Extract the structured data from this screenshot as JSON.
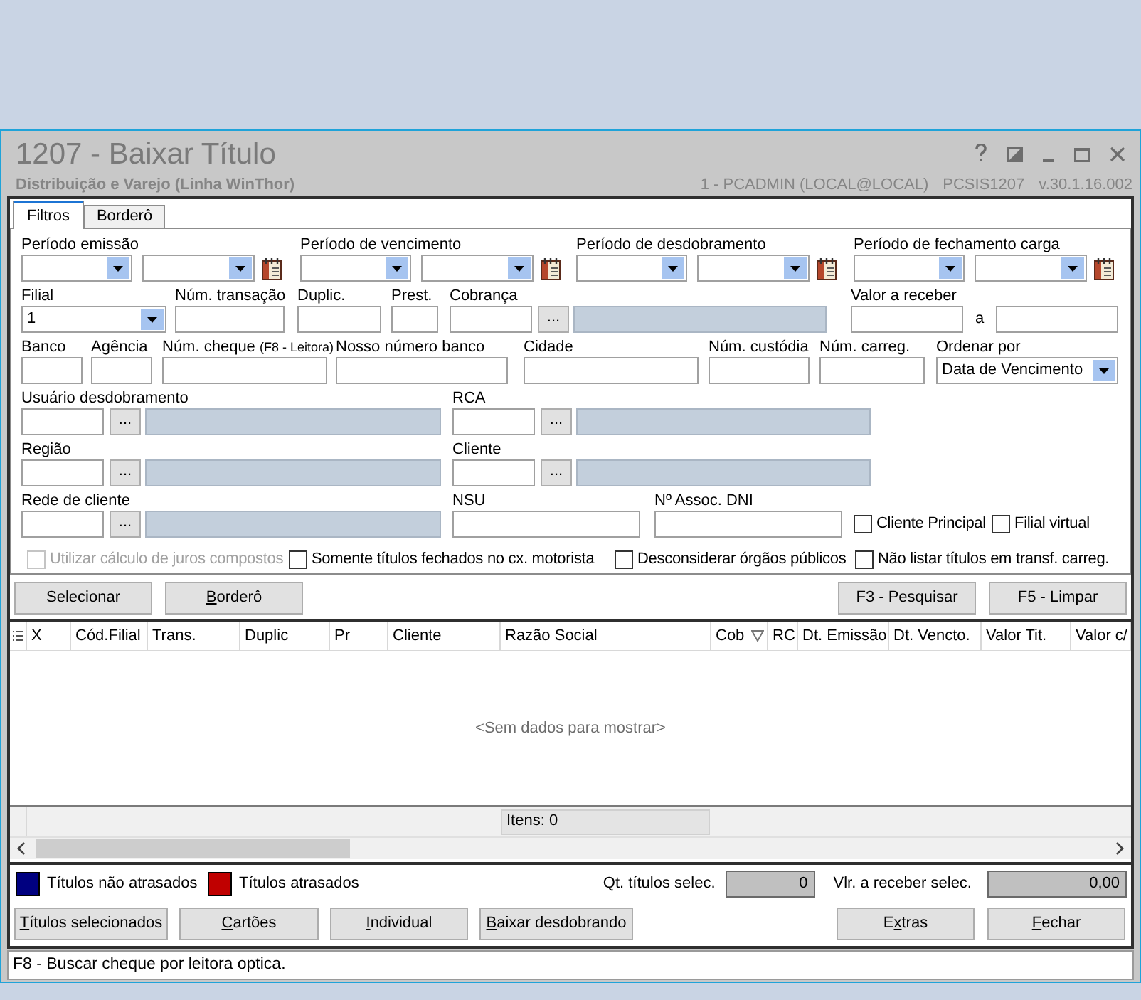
{
  "window": {
    "title": "1207 - Baixar Título",
    "subtitle": "Distribuição e Varejo (Linha WinThor)",
    "user": "1 - PCADMIN (LOCAL@LOCAL)",
    "program": "PCSIS1207",
    "version": "v.30.1.16.002"
  },
  "tabs": [
    {
      "label": "Filtros",
      "selected": true
    },
    {
      "label": "Borderô",
      "selected": false
    }
  ],
  "rows": [
    [
      {
        "kind": "period",
        "label": "Período emissão"
      },
      {
        "kind": "period",
        "label": "Período de vencimento"
      },
      {
        "kind": "period",
        "label": "Período de desdobramento"
      },
      {
        "kind": "period",
        "label": "Período de fechamento carga"
      }
    ],
    [
      {
        "kind": "combo",
        "label": "Filial",
        "value": "1"
      },
      {
        "kind": "text",
        "label": "Núm. transação"
      },
      {
        "kind": "text",
        "label": "Duplic."
      },
      {
        "kind": "text",
        "label": "Prest."
      },
      {
        "kind": "lookup",
        "label": "Cobrança",
        "button": "..."
      },
      {
        "kind": "range",
        "label": "Valor a receber",
        "separator": "a"
      }
    ],
    [
      {
        "kind": "text",
        "label": "Banco"
      },
      {
        "kind": "text",
        "label": "Agência"
      },
      {
        "kind": "text",
        "label": "Núm. cheque",
        "note": "(F8 - Leitora)"
      },
      {
        "kind": "text",
        "label": "Nosso número banco"
      },
      {
        "kind": "text",
        "label": "Cidade"
      },
      {
        "kind": "text",
        "label": "Núm. custódia"
      },
      {
        "kind": "text",
        "label": "Núm. carreg."
      },
      {
        "kind": "combo",
        "label": "Ordenar por",
        "value": "Data de Vencimento"
      }
    ],
    [
      {
        "kind": "lookup",
        "label": "Usuário desdobramento",
        "button": "..."
      },
      {
        "kind": "lookup",
        "label": "RCA",
        "button": "..."
      }
    ],
    [
      {
        "kind": "lookup",
        "label": "Região",
        "button": "..."
      },
      {
        "kind": "lookup",
        "label": "Cliente",
        "button": "..."
      }
    ],
    [
      {
        "kind": "lookup",
        "label": "Rede de cliente",
        "button": "..."
      },
      {
        "kind": "text",
        "label": "NSU"
      },
      {
        "kind": "text",
        "label": "Nº Assoc. DNI"
      },
      {
        "kind": "checkbox",
        "label": "Cliente Principal",
        "checked": false,
        "disabled": false
      },
      {
        "kind": "checkbox",
        "label": "Filial virtual",
        "checked": false,
        "disabled": false
      }
    ]
  ],
  "options": [
    {
      "label": "Utilizar cálculo de juros compostos",
      "checked": false,
      "disabled": true
    },
    {
      "label": "Somente títulos fechados no cx. motorista",
      "checked": false,
      "disabled": false
    },
    {
      "label": "Desconsiderar órgãos públicos",
      "checked": false,
      "disabled": false
    },
    {
      "label": "Não listar títulos em transf. carreg.",
      "checked": false,
      "disabled": false
    }
  ],
  "actions": [
    {
      "label": "Selecionar"
    },
    {
      "label": "Borderô"
    },
    {
      "label": "F3 - Pesquisar"
    },
    {
      "label": "F5 - Limpar"
    }
  ],
  "grid": {
    "columns": [
      {
        "label": "X",
        "filter": false
      },
      {
        "label": "Cód.Filial",
        "filter": false
      },
      {
        "label": "Trans.",
        "filter": false
      },
      {
        "label": "Duplic",
        "filter": false
      },
      {
        "label": "Pr",
        "filter": false
      },
      {
        "label": "Cliente",
        "filter": false
      },
      {
        "label": "Razão Social",
        "filter": false
      },
      {
        "label": "Cob",
        "filter": true
      },
      {
        "label": "RC",
        "filter": false
      },
      {
        "label": "Dt. Emissão",
        "filter": false
      },
      {
        "label": "Dt. Vencto.",
        "filter": false
      },
      {
        "label": "Valor Tit.",
        "filter": false
      },
      {
        "label": "Valor c/",
        "filter": false
      }
    ],
    "empty_text": "<Sem dados para mostrar>",
    "footer": "Itens: 0"
  },
  "legend": [
    {
      "label": "Títulos não atrasados",
      "color": "#000080"
    },
    {
      "label": "Títulos atrasados",
      "color": "#c00000"
    }
  ],
  "totals": [
    {
      "label": "Qt. títulos selec.",
      "value": "0"
    },
    {
      "label": "Vlr. a receber selec.",
      "value": "0,00"
    }
  ],
  "buttons": [
    {
      "label": "Títulos selecionados"
    },
    {
      "label": "Cartões"
    },
    {
      "label": "Individual"
    },
    {
      "label": "Baixar desdobrando"
    },
    {
      "label": "Extras"
    },
    {
      "label": "Fechar"
    }
  ],
  "status_bar": "F8 - Buscar cheque por leitora optica."
}
